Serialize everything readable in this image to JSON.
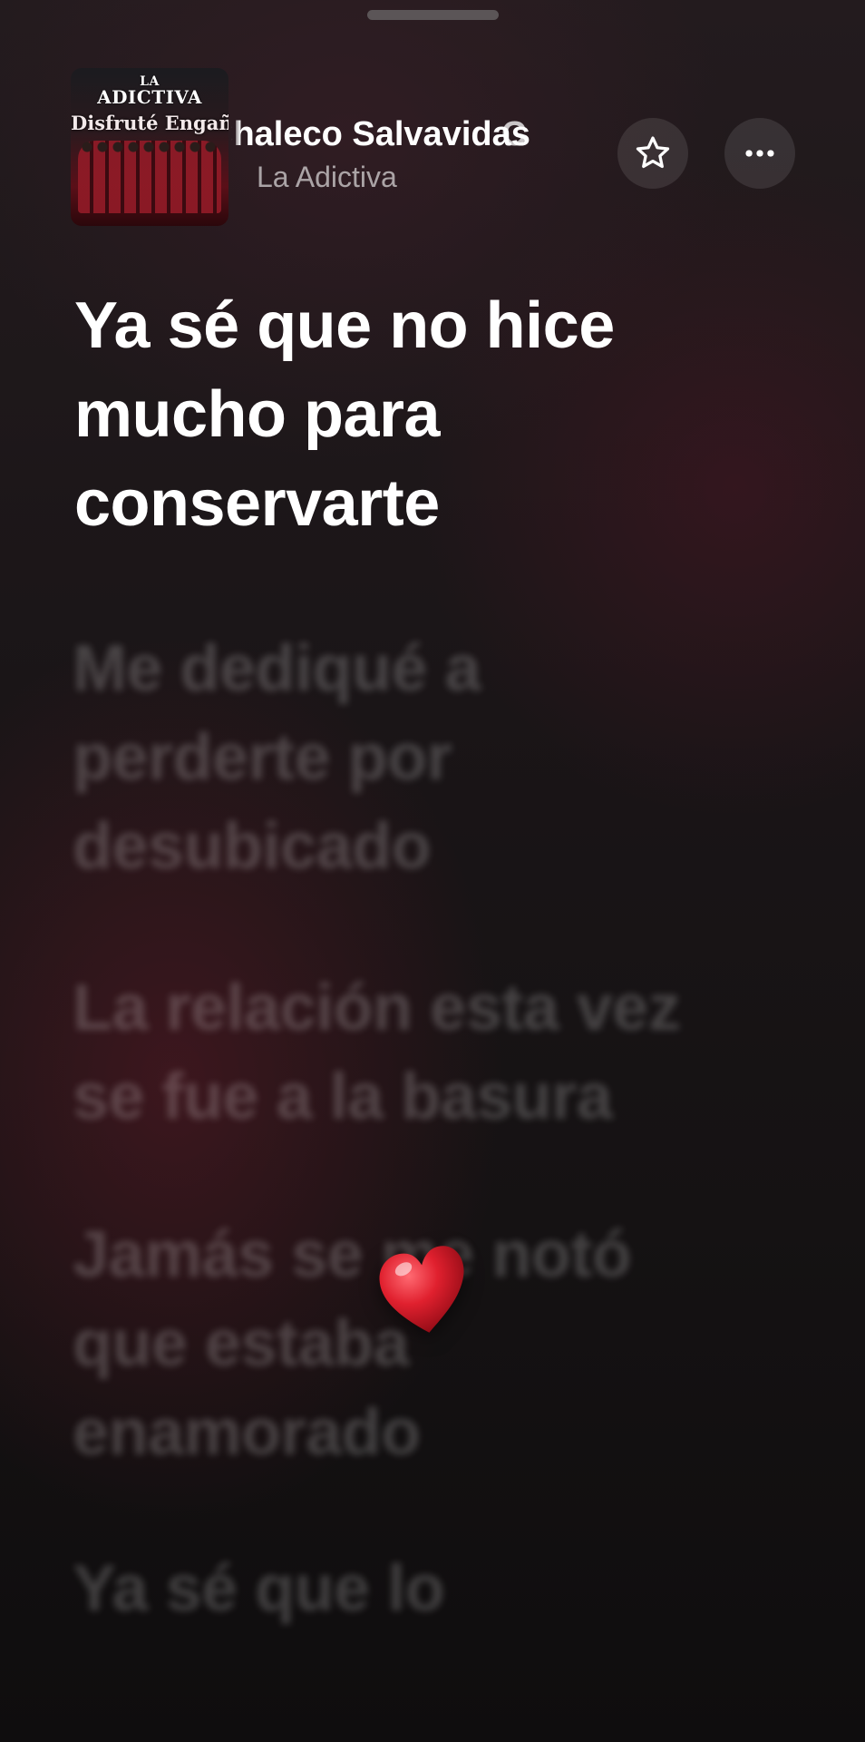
{
  "header": {
    "album_art": {
      "band_top": "LA",
      "band_main": "ADICTIVA",
      "album_name": "Disfruté Engañarte"
    },
    "song_title": "Chaleco Salvavidas",
    "next_title_peek": "C",
    "artist": "La Adictiva",
    "icons": {
      "favorite": "star-icon",
      "more": "ellipsis-icon"
    }
  },
  "lyrics": {
    "current": [
      "Ya sé que no hice",
      "mucho para",
      "conservarte"
    ],
    "upcoming": [
      [
        "Me dediqué a",
        "perderte por",
        "desubicado"
      ],
      [
        "La relación esta vez",
        "se fue a la basura"
      ],
      [
        "Jamás se me notó",
        "que estaba",
        "enamorado"
      ],
      [
        "Ya sé que lo"
      ]
    ]
  },
  "reaction": {
    "icon": "heart-icon",
    "color": "#d8202e"
  },
  "colors": {
    "background": "#141112",
    "accent": "#8e1a26"
  }
}
